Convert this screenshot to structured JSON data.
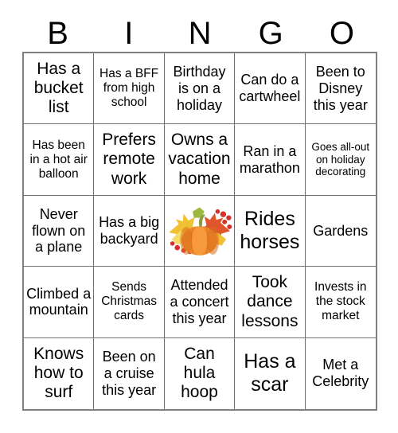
{
  "card": {
    "title_letters": [
      "B",
      "I",
      "N",
      "G",
      "O"
    ],
    "grid_size": "5x5",
    "colors": {
      "outer_border": "#808080",
      "inner_grid_line": "#6f6f6f",
      "text": "#000000",
      "background": "#ffffff",
      "pumpkin_orange": "#f08a2a",
      "pumpkin_shade": "#d9701c",
      "stem_green": "#8a9a3c",
      "leaf_gold": "#f0c132",
      "leaf_yellow": "#f5db6a",
      "leaf_red": "#e0552b",
      "leaf_green": "#9cb83f",
      "berry_red": "#d7312b"
    },
    "rows": [
      [
        {
          "text": "Has a bucket list",
          "size": "lg",
          "type": "text"
        },
        {
          "text": "Has a BFF from high school",
          "size": "sm",
          "type": "text"
        },
        {
          "text": "Birthday is on a holiday",
          "size": "md",
          "type": "text"
        },
        {
          "text": "Can do a cartwheel",
          "size": "md",
          "type": "text"
        },
        {
          "text": "Been to Disney this year",
          "size": "md",
          "type": "text"
        }
      ],
      [
        {
          "text": "Has been in a hot air balloon",
          "size": "sm",
          "type": "text"
        },
        {
          "text": "Prefers remote work",
          "size": "lg",
          "type": "text"
        },
        {
          "text": "Owns a vacation home",
          "size": "lg",
          "type": "text"
        },
        {
          "text": "Ran in a marathon",
          "size": "md",
          "type": "text"
        },
        {
          "text": "Goes all-out on holiday decorating",
          "size": "xs",
          "type": "text"
        }
      ],
      [
        {
          "text": "Never flown on a plane",
          "size": "md",
          "type": "text"
        },
        {
          "text": "Has a big backyard",
          "size": "md",
          "type": "text"
        },
        {
          "text": "",
          "size": "md",
          "type": "image",
          "image_name": "autumn-pumpkin-leaves-free-space"
        },
        {
          "text": "Rides horses",
          "size": "xl",
          "type": "text"
        },
        {
          "text": "Gardens",
          "size": "md",
          "type": "text"
        }
      ],
      [
        {
          "text": "Climbed a mountain",
          "size": "md",
          "type": "text"
        },
        {
          "text": "Sends Christmas cards",
          "size": "sm",
          "type": "text"
        },
        {
          "text": "Attended a concert this year",
          "size": "md",
          "type": "text"
        },
        {
          "text": "Took dance lessons",
          "size": "lg",
          "type": "text"
        },
        {
          "text": "Invests in the stock market",
          "size": "sm",
          "type": "text"
        }
      ],
      [
        {
          "text": "Knows how to surf",
          "size": "lg",
          "type": "text"
        },
        {
          "text": "Been on a cruise this year",
          "size": "md",
          "type": "text"
        },
        {
          "text": "Can hula hoop",
          "size": "lg",
          "type": "text"
        },
        {
          "text": "Has a scar",
          "size": "xl",
          "type": "text"
        },
        {
          "text": "Met a Celebrity",
          "size": "md",
          "type": "text"
        }
      ]
    ]
  }
}
